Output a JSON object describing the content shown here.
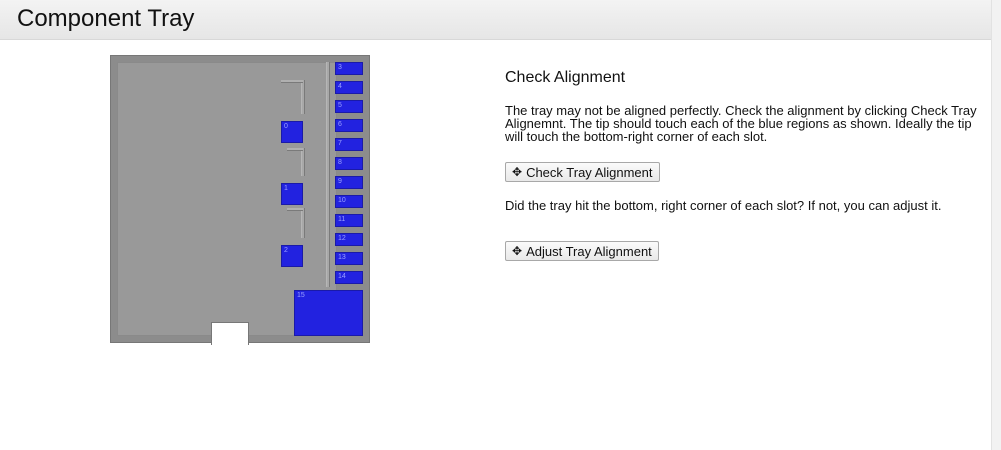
{
  "header": {
    "title": "Component Tray"
  },
  "tray": {
    "slot_color": "#2222e0",
    "slots": [
      {
        "label": "3"
      },
      {
        "label": "4"
      },
      {
        "label": "5"
      },
      {
        "label": "6"
      },
      {
        "label": "7"
      },
      {
        "label": "8"
      },
      {
        "label": "9"
      },
      {
        "label": "10"
      },
      {
        "label": "11"
      },
      {
        "label": "12"
      },
      {
        "label": "13"
      },
      {
        "label": "14"
      },
      {
        "label": "15"
      },
      {
        "label": "0"
      },
      {
        "label": "1"
      },
      {
        "label": "2"
      }
    ]
  },
  "panel": {
    "heading": "Check Alignment",
    "instructions": "The tray may not be aligned perfectly. Check the alignment by clicking Check Tray Alignemnt. The tip should touch each of the blue regions as shown. Ideally the tip will touch the bottom-right corner of each slot.",
    "check_button": {
      "icon": "move-arrows-icon",
      "label": "Check Tray Alignment"
    },
    "question": "Did the tray hit the bottom, right corner of each slot? If not, you can adjust it.",
    "adjust_button": {
      "icon": "move-arrows-icon",
      "label": "Adjust Tray Alignment"
    }
  }
}
